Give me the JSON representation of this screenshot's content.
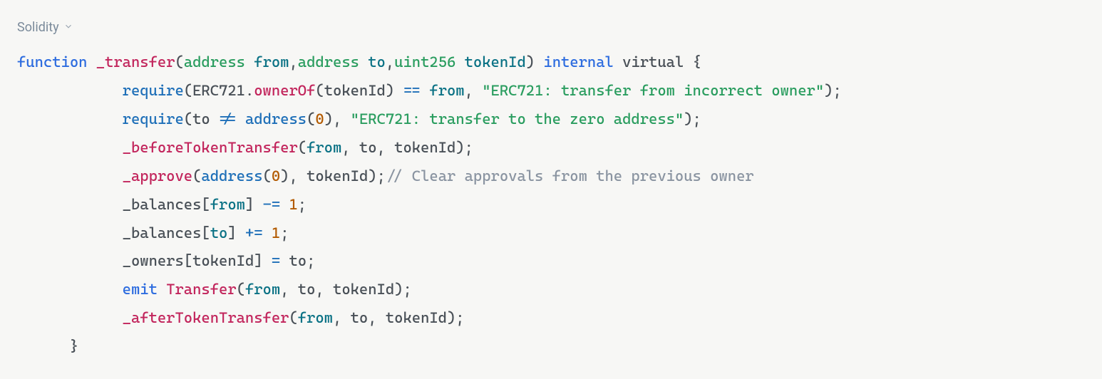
{
  "language_label": "Solidity",
  "code": {
    "line1": {
      "kw_function": "function",
      "fn_name": "_transfer",
      "p1_type": "address",
      "p1_name": "from",
      "p2_type": "address",
      "p2_name": "to",
      "p3_type": "uint256",
      "p3_name": "tokenId",
      "kw_internal": "internal",
      "kw_virtual": "virtual"
    },
    "line2": {
      "require": "require",
      "erc721": "ERC721",
      "ownerOf": "ownerOf",
      "tokenId": "tokenId",
      "eq": "==",
      "from": "from",
      "str": "\"ERC721: transfer from incorrect owner\""
    },
    "line3": {
      "require": "require",
      "to": "to",
      "neq": "!=",
      "address": "address",
      "zero": "0",
      "str": "\"ERC721: transfer to the zero address\""
    },
    "line4": {
      "before": "_beforeTokenTransfer",
      "from": "from",
      "to": "to",
      "tokenId": "tokenId"
    },
    "line5": {
      "approve": "_approve",
      "address": "address",
      "zero": "0",
      "tokenId": "tokenId",
      "comment": "// Clear approvals from the previous owner"
    },
    "line6": {
      "balances": "_balances",
      "from": "from",
      "op": "-=",
      "one": "1"
    },
    "line7": {
      "balances": "_balances",
      "to": "to",
      "op": "+=",
      "one": "1"
    },
    "line8": {
      "owners": "_owners",
      "tokenId": "tokenId",
      "eq": "=",
      "to": "to"
    },
    "line9": {
      "emit": "emit",
      "transfer": "Transfer",
      "from": "from",
      "to": "to",
      "tokenId": "tokenId"
    },
    "line10": {
      "after": "_afterTokenTransfer",
      "from": "from",
      "to": "to",
      "tokenId": "tokenId"
    }
  }
}
